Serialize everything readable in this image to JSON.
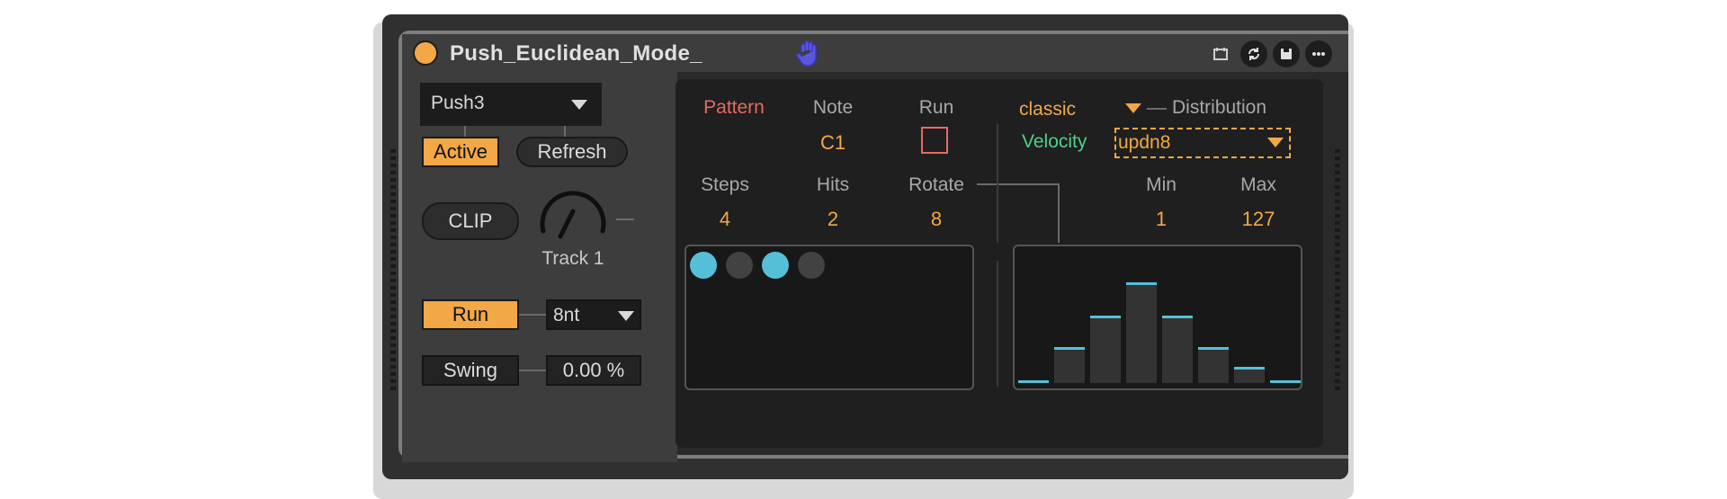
{
  "window": {
    "title": "Push_Euclidean_Mode_"
  },
  "left": {
    "device_select": "Push3",
    "active_label": "Active",
    "refresh_label": "Refresh",
    "clip_label": "CLIP",
    "track_label": "Track 1",
    "run_label": "Run",
    "rate_select": "8nt",
    "swing_label": "Swing",
    "swing_value": "0.00 %"
  },
  "pattern": {
    "pattern_label": "Pattern",
    "note_label": "Note",
    "note_value": "C1",
    "run_label": "Run",
    "steps_label": "Steps",
    "steps_value": "4",
    "hits_label": "Hits",
    "hits_value": "2",
    "rotate_label": "Rotate",
    "rotate_value": "8",
    "step_states": [
      true,
      false,
      true,
      false
    ]
  },
  "velocity": {
    "mode_value": "classic",
    "distribution_label": "Distribution",
    "velocity_label": "Velocity",
    "velocity_select": "updn8",
    "min_label": "Min",
    "min_value": "1",
    "max_label": "Max",
    "max_value": "127",
    "distribution_levels": [
      0.0,
      0.32,
      0.62,
      0.94,
      0.62,
      0.32,
      0.13,
      0.0
    ]
  },
  "colors": {
    "accent": "#f2a846",
    "pattern_label": "#e46b63",
    "velocity_label": "#4fcf8a",
    "step_on": "#56bfd8",
    "step_off": "#424242",
    "run_box": "#e46b63"
  }
}
